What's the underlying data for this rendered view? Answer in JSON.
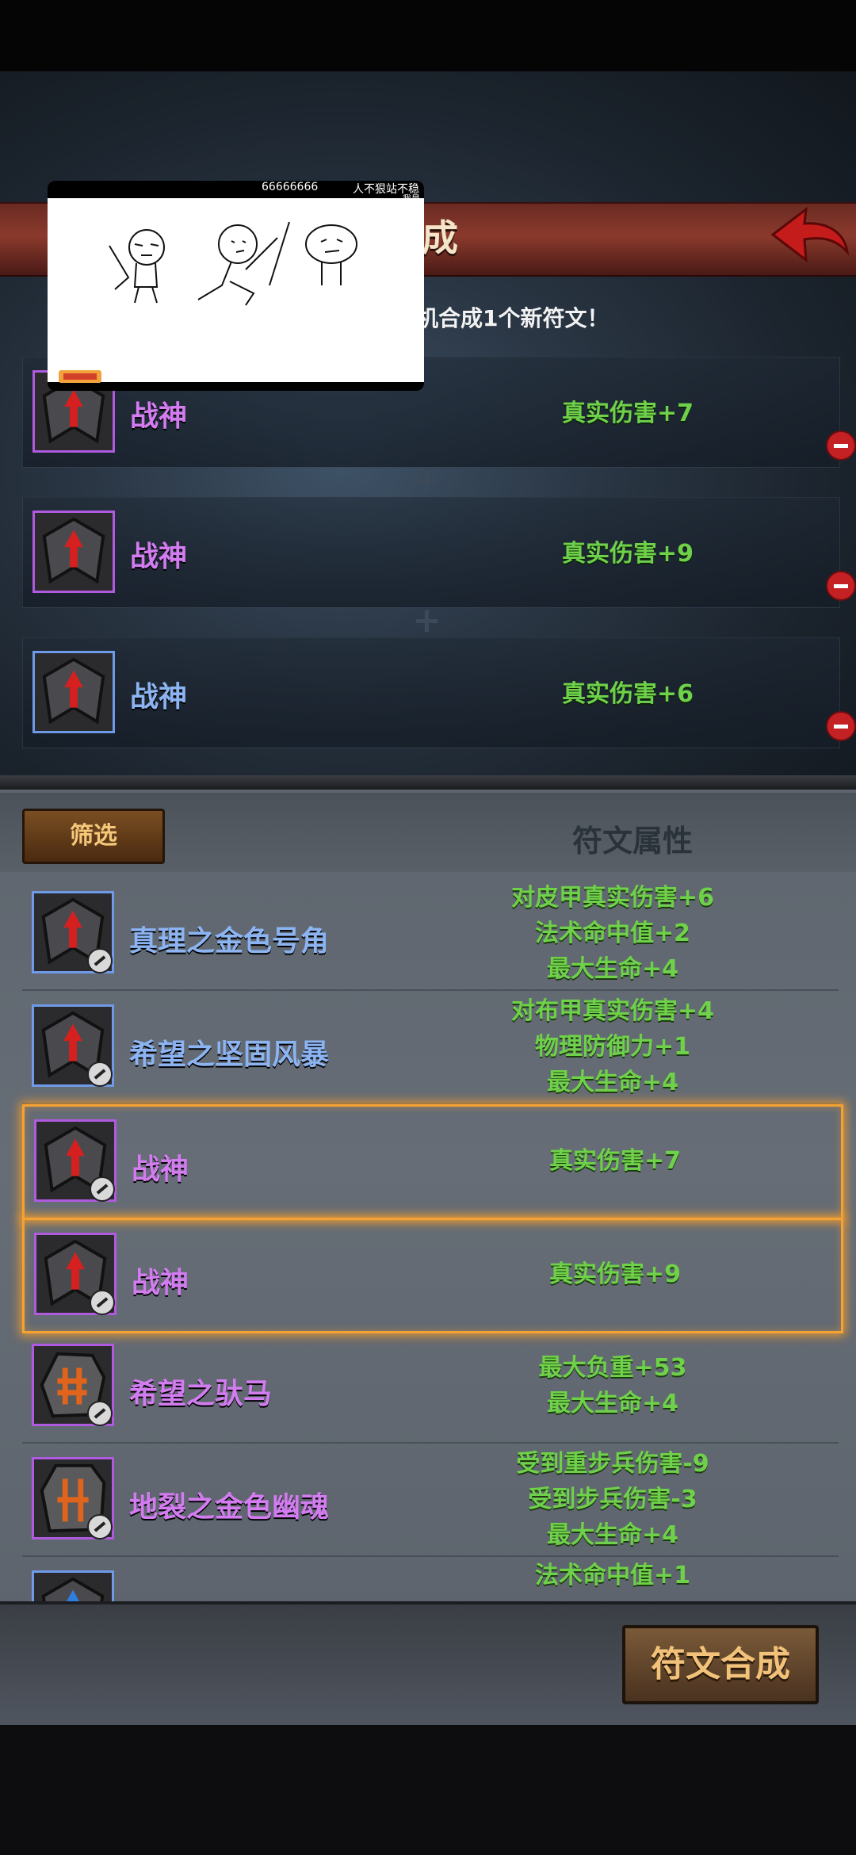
{
  "header": {
    "title": "文合成",
    "instruction": "机合成1个新符文！"
  },
  "overlay": {
    "text1": "66666666",
    "text2": "人不狠站不稳",
    "text3": "我是"
  },
  "slots": [
    {
      "name": "战神",
      "stat": "真实伤害+7",
      "rarity": "purple"
    },
    {
      "name": "战神",
      "stat": "真实伤害+9",
      "rarity": "purple"
    },
    {
      "name": "战神",
      "stat": "真实伤害+6",
      "rarity": "blue"
    }
  ],
  "list": {
    "filter_label": "筛选",
    "attr_header": "符文属性",
    "items": [
      {
        "name": "真理之金色号角",
        "rarity": "blue",
        "stats": [
          "对皮甲真实伤害+6",
          "法术命中值+2",
          "最大生命+4"
        ]
      },
      {
        "name": "希望之坚固风暴",
        "rarity": "blue",
        "stats": [
          "对布甲真实伤害+4",
          "物理防御力+1",
          "最大生命+4"
        ]
      },
      {
        "name": "战神",
        "rarity": "purple",
        "selected": true,
        "stats": [
          "真实伤害+7"
        ]
      },
      {
        "name": "战神",
        "rarity": "purple",
        "selected": true,
        "stats": [
          "真实伤害+9"
        ]
      },
      {
        "name": "希望之驮马",
        "rarity": "purple",
        "stats": [
          "最大负重+53",
          "最大生命+4"
        ]
      },
      {
        "name": "地裂之金色幽魂",
        "rarity": "purple",
        "stats": [
          "受到重步兵伤害-9",
          "受到步兵伤害-3",
          "最大生命+4"
        ]
      },
      {
        "name": "",
        "rarity": "blue",
        "stats": [
          "法术命中值+1"
        ]
      }
    ]
  },
  "footer": {
    "compose_label": "符文合成"
  },
  "colors": {
    "purple": "#d27cf0",
    "blue": "#8cb4f2",
    "stat_green": "#6fd14a",
    "selected_orange": "#f4a233"
  }
}
